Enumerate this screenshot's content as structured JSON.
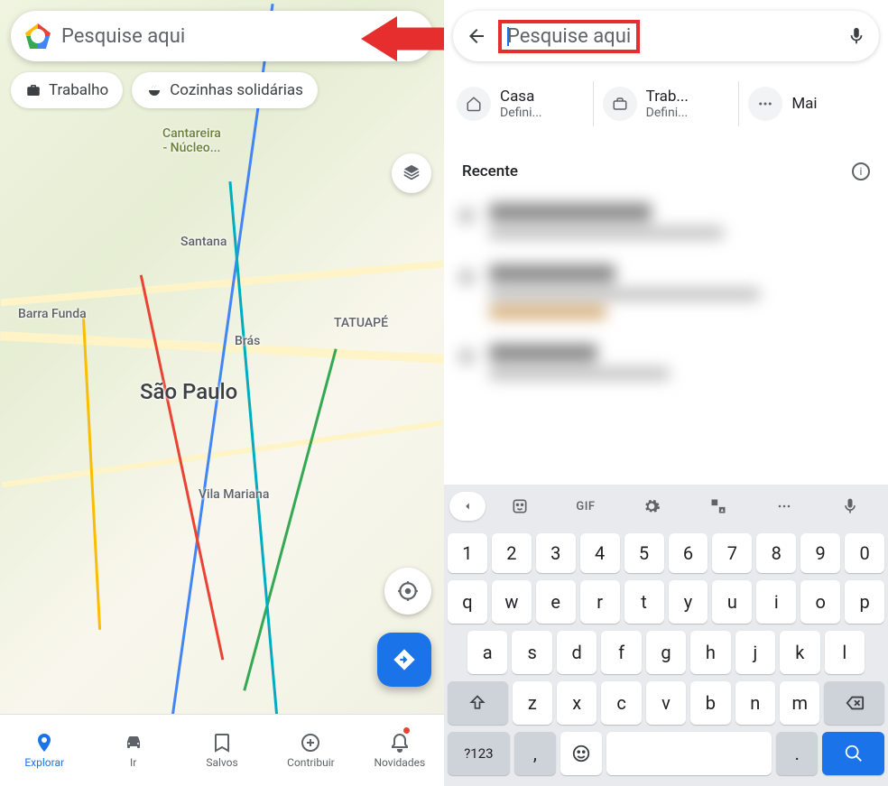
{
  "left": {
    "search_placeholder": "Pesquise aqui",
    "chips": [
      {
        "icon": "briefcase-icon",
        "label": "Trabalho"
      },
      {
        "icon": "soup-icon",
        "label": "Cozinhas solidárias"
      }
    ],
    "map_labels": {
      "cantareira": "Cantareira\n- Núcleo...",
      "santana": "Santana",
      "barra_funda": "Barra Funda",
      "bras": "Brás",
      "tatuape": "TATUAPÉ",
      "sao_paulo": "São Paulo",
      "vila_mariana": "Vila Mariana"
    },
    "bottom_nav": [
      {
        "icon": "pin-icon",
        "label": "Explorar",
        "active": true
      },
      {
        "icon": "car-icon",
        "label": "Ir",
        "active": false
      },
      {
        "icon": "bookmark-icon",
        "label": "Salvos",
        "active": false
      },
      {
        "icon": "plus-circle-icon",
        "label": "Contribuir",
        "active": false
      },
      {
        "icon": "bell-icon",
        "label": "Novidades",
        "active": false,
        "badge": true
      }
    ]
  },
  "right": {
    "search_placeholder": "Pesquise aqui",
    "shortcuts": [
      {
        "icon": "home-icon",
        "title": "Casa",
        "subtitle": "Defini..."
      },
      {
        "icon": "briefcase-icon",
        "title": "Trab...",
        "subtitle": "Defini..."
      },
      {
        "icon": "more-icon",
        "title": "Mai",
        "subtitle": ""
      }
    ],
    "recent_label": "Recente",
    "keyboard": {
      "toolbar": [
        "chevron-left-icon",
        "sticker-icon",
        "GIF",
        "gear-icon",
        "translate-icon",
        "more-icon",
        "mic-icon"
      ],
      "row_num": [
        "1",
        "2",
        "3",
        "4",
        "5",
        "6",
        "7",
        "8",
        "9",
        "0"
      ],
      "row_q": [
        "q",
        "w",
        "e",
        "r",
        "t",
        "y",
        "u",
        "i",
        "o",
        "p"
      ],
      "row_a": [
        "a",
        "s",
        "d",
        "f",
        "g",
        "h",
        "j",
        "k",
        "l"
      ],
      "row_z": [
        "z",
        "x",
        "c",
        "v",
        "b",
        "n",
        "m"
      ],
      "shift": "shift-icon",
      "backspace": "backspace-icon",
      "sym": "?123",
      "comma": ",",
      "emoji": "emoji-icon",
      "period": ".",
      "enter": "search-icon"
    }
  },
  "colors": {
    "accent_blue": "#1a73e8",
    "arrow_red": "#e62e2e"
  }
}
